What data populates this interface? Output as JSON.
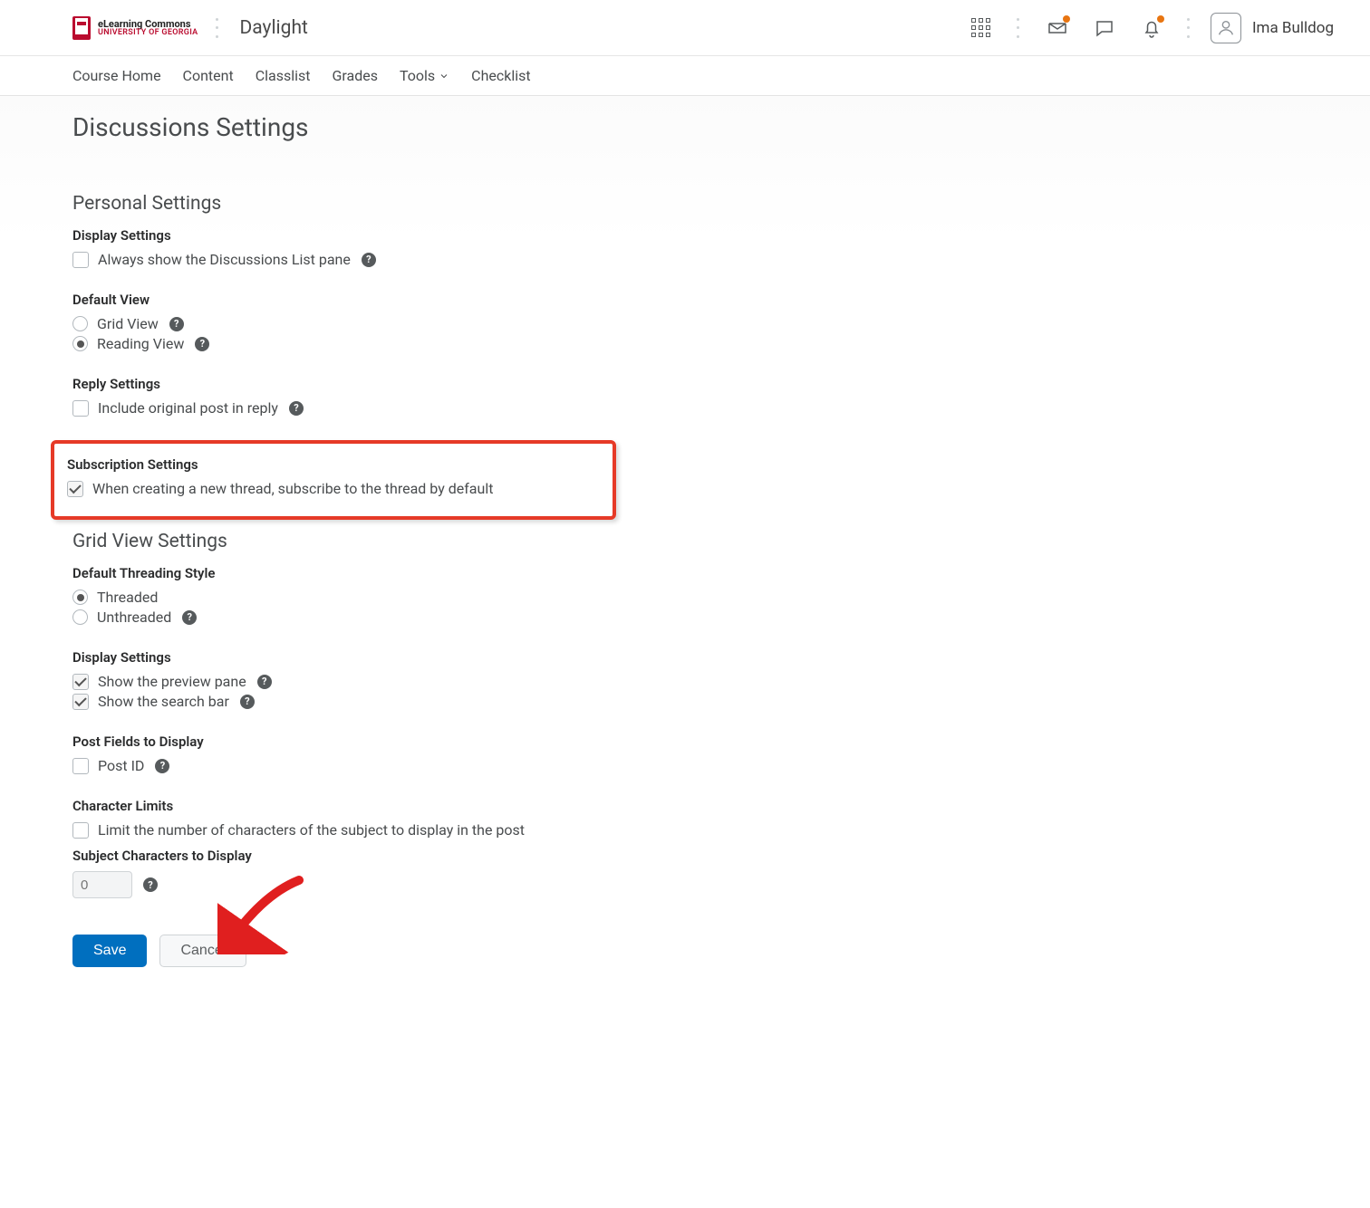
{
  "header": {
    "logo": {
      "line1": "eLearning Commons",
      "line2": "UNIVERSITY OF GEORGIA"
    },
    "course_name": "Daylight",
    "username": "Ima Bulldog"
  },
  "nav": {
    "items": [
      "Course Home",
      "Content",
      "Classlist",
      "Grades",
      "Tools",
      "Checklist"
    ]
  },
  "page": {
    "title": "Discussions Settings",
    "personal": {
      "heading": "Personal Settings",
      "display": {
        "heading": "Display Settings",
        "always_show_label": "Always show the Discussions List pane"
      },
      "default_view": {
        "heading": "Default View",
        "grid_label": "Grid View",
        "reading_label": "Reading View"
      },
      "reply": {
        "heading": "Reply Settings",
        "include_label": "Include original post in reply"
      },
      "subscription": {
        "heading": "Subscription Settings",
        "auto_sub_label": "When creating a new thread, subscribe to the thread by default"
      }
    },
    "gridview": {
      "heading": "Grid View Settings",
      "threading": {
        "heading": "Default Threading Style",
        "threaded_label": "Threaded",
        "unthreaded_label": "Unthreaded"
      },
      "display": {
        "heading": "Display Settings",
        "preview_label": "Show the preview pane",
        "search_label": "Show the search bar"
      },
      "postfields": {
        "heading": "Post Fields to Display",
        "postid_label": "Post ID"
      },
      "charlimits": {
        "heading": "Character Limits",
        "limit_label": "Limit the number of characters of the subject to display in the post",
        "subject_chars_heading": "Subject Characters to Display",
        "subject_chars_value": "0"
      }
    },
    "buttons": {
      "save": "Save",
      "cancel": "Cancel"
    }
  }
}
